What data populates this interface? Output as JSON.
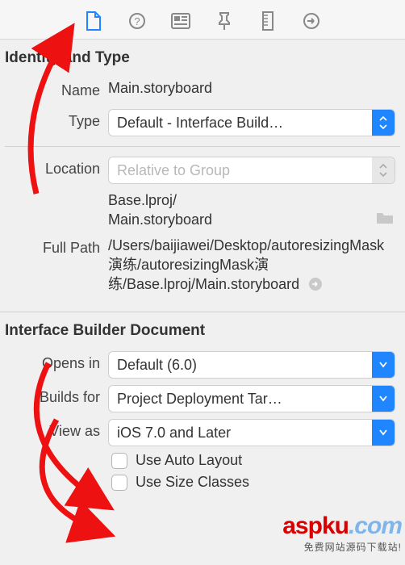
{
  "toolbar": {
    "icons": [
      "file-icon",
      "help-icon",
      "identity-icon",
      "pin-icon",
      "ruler-icon",
      "connections-icon"
    ]
  },
  "sections": {
    "identity_title": "Identity and Type",
    "ibdoc_title": "Interface Builder Document"
  },
  "identity": {
    "name_label": "Name",
    "name_value": "Main.storyboard",
    "type_label": "Type",
    "type_value": "Default - Interface Build…",
    "location_label": "Location",
    "location_value": "Relative to Group",
    "location_path": "Base.lproj/\nMain.storyboard",
    "fullpath_label": "Full Path",
    "fullpath_value": "/Users/baijiawei/Desktop/autoresizingMask演练/autoresizingMask演练/Base.lproj/Main.storyboard"
  },
  "ibdoc": {
    "opensin_label": "Opens in",
    "opensin_value": "Default (6.0)",
    "buildsfor_label": "Builds for",
    "buildsfor_value": "Project Deployment Tar…",
    "viewas_label": "View as",
    "viewas_value": "iOS 7.0 and Later",
    "use_autolayout": "Use Auto Layout",
    "use_sizeclasses": "Use Size Classes"
  },
  "watermark": {
    "brand": "aspku",
    "tld": ".com",
    "sub": "免费网站源码下载站!"
  }
}
